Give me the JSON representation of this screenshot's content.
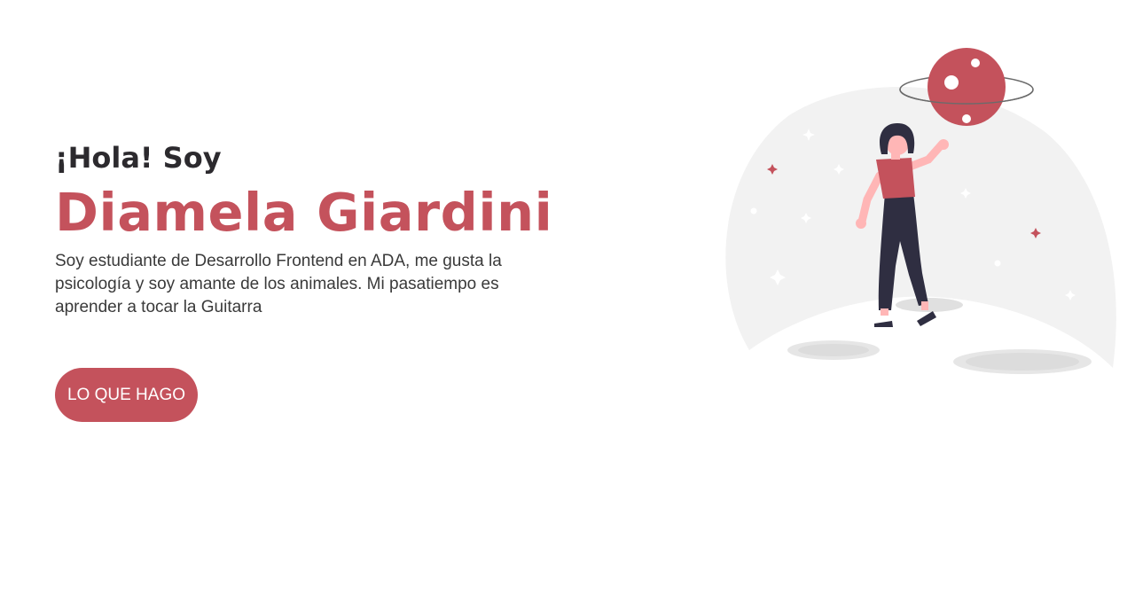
{
  "hero": {
    "greeting": "¡Hola! Soy",
    "name": "Diamela Giardini",
    "bio": "Soy estudiante de Desarrollo Frontend en ADA, me gusta la psicología y soy amante de los animales. Mi pasatiempo es aprender a tocar la Guitarra",
    "cta_label": "LO QUE HAGO"
  },
  "theme": {
    "accent": "#c4525c",
    "text_dark": "#2c2a2e",
    "illustration_bg": "#f2f2f2",
    "figure_pants": "#2f2e41",
    "figure_skin": "#ffb6b6"
  }
}
